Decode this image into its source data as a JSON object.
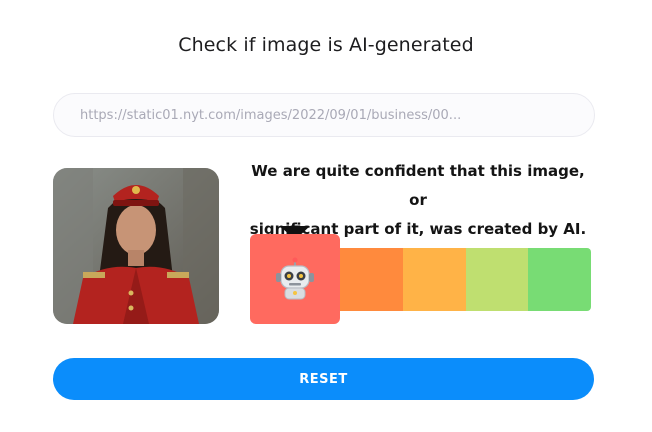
{
  "title": "Check if image is AI-generated",
  "url_input": {
    "value": "https://static01.nyt.com/images/2022/09/01/business/00..."
  },
  "result": {
    "line1": "We are quite confident that this image, or",
    "line2": "significant part of it, was created by AI."
  },
  "meter": {
    "active_index": 0,
    "active_icon": "robot-icon",
    "colors": [
      "#ff6a5f",
      "#ff8a3d",
      "#ffb347",
      "#bfdf70",
      "#78dc74"
    ]
  },
  "reset_label": "RESET",
  "image_icon": "uploaded-photo"
}
